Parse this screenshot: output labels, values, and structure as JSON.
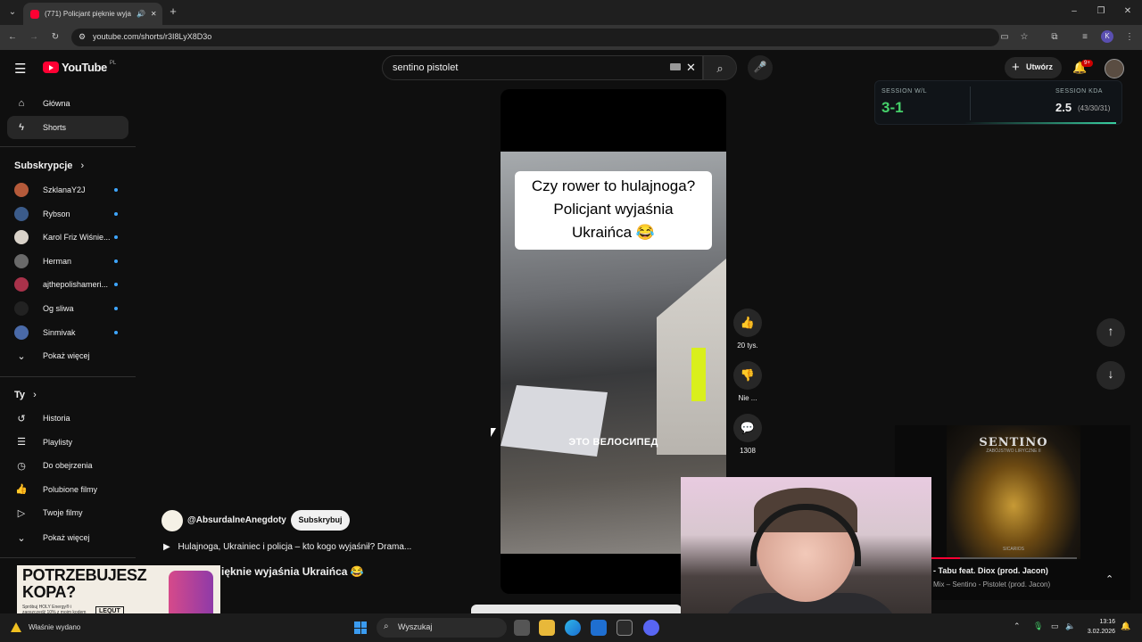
{
  "browser": {
    "tab_title": "(771) Policjant pięknie wyja",
    "url": "youtube.com/shorts/r3I8LyX8D3o",
    "profile_letter": "K"
  },
  "header": {
    "logo_text": "YouTube",
    "logo_region": "PL",
    "search_value": "sentino pistolet",
    "create_label": "Utwórz",
    "notification_count": "9+"
  },
  "sidebar": {
    "main": [
      {
        "label": "Główna",
        "icon": "home-icon"
      },
      {
        "label": "Shorts",
        "icon": "shorts-icon"
      }
    ],
    "subscriptions_title": "Subskrypcje",
    "subscriptions": [
      {
        "label": "SzklanaY2J",
        "color": "#b55a3a"
      },
      {
        "label": "Rybson",
        "color": "#3b5b8a"
      },
      {
        "label": "Karol Friz Wiśnie...",
        "color": "#d9d2c9"
      },
      {
        "label": "Herman",
        "color": "#6a6a6a"
      },
      {
        "label": "ajthepolishameri...",
        "color": "#a8324a"
      },
      {
        "label": "Og sliwa",
        "color": "#222222"
      },
      {
        "label": "Sinmivak",
        "color": "#4a6aa8"
      }
    ],
    "show_more": "Pokaż więcej",
    "you_title": "Ty",
    "you_items": [
      {
        "label": "Historia",
        "icon": "history-icon"
      },
      {
        "label": "Playlisty",
        "icon": "playlist-icon"
      },
      {
        "label": "Do obejrzenia",
        "icon": "watch-later-icon"
      },
      {
        "label": "Polubione filmy",
        "icon": "like-icon"
      },
      {
        "label": "Twoje filmy",
        "icon": "your-videos-icon"
      }
    ],
    "show_more_2": "Pokaż więcej"
  },
  "video": {
    "caption_lines": [
      "Czy rower to hulajnoga?",
      "Policjant wyjaśnia",
      "Ukraińca 😂"
    ],
    "russian_caption": "ЭТО ВЕЛОСИПЕД",
    "channel": "@AbsurdalneAnegdoty",
    "subscribe": "Subskrybuj",
    "playlist": "Hulajnoga, Ukrainiec i policja – kto kogo wyjaśnił? Drama...",
    "title_visible": "ięknie wyjaśnia Ukraińca 😂"
  },
  "actions": {
    "likes": "20 tys.",
    "dislike_label": "Nie ...",
    "comments": "1308"
  },
  "session_overlay": {
    "wl_label": "SESSION W/L",
    "wl_value": "3-1",
    "kda_label": "SESSION KDA",
    "kda_value": "2.5",
    "kda_detail": "(43/30/31)"
  },
  "music_overlay": {
    "album_title": "SENTINO",
    "album_subtitle": "ZABÓJSTWO LIRYCZNE II",
    "album_footer": "SICARIOS",
    "song": "- Tabu feat. Diox (prod. Jacon)",
    "artist": "Mix – Sentino - Pistolet (prod. Jacon)",
    "progress": 0.2
  },
  "ad": {
    "headline": "POTRZEBUJESZ KOPA?",
    "subtext": "Spróbuj HOLY Energy® i zaoszczędź 10% z moim kodem",
    "code": "LEQUT"
  },
  "taskbar": {
    "notification": "Właśnie wydano",
    "search": "Wyszukaj",
    "time": "13:16",
    "date": "3.02.2026"
  },
  "colors": {
    "accent": "#ff0033",
    "session_green": "#45d06a",
    "link_blue": "#3ea6ff"
  }
}
